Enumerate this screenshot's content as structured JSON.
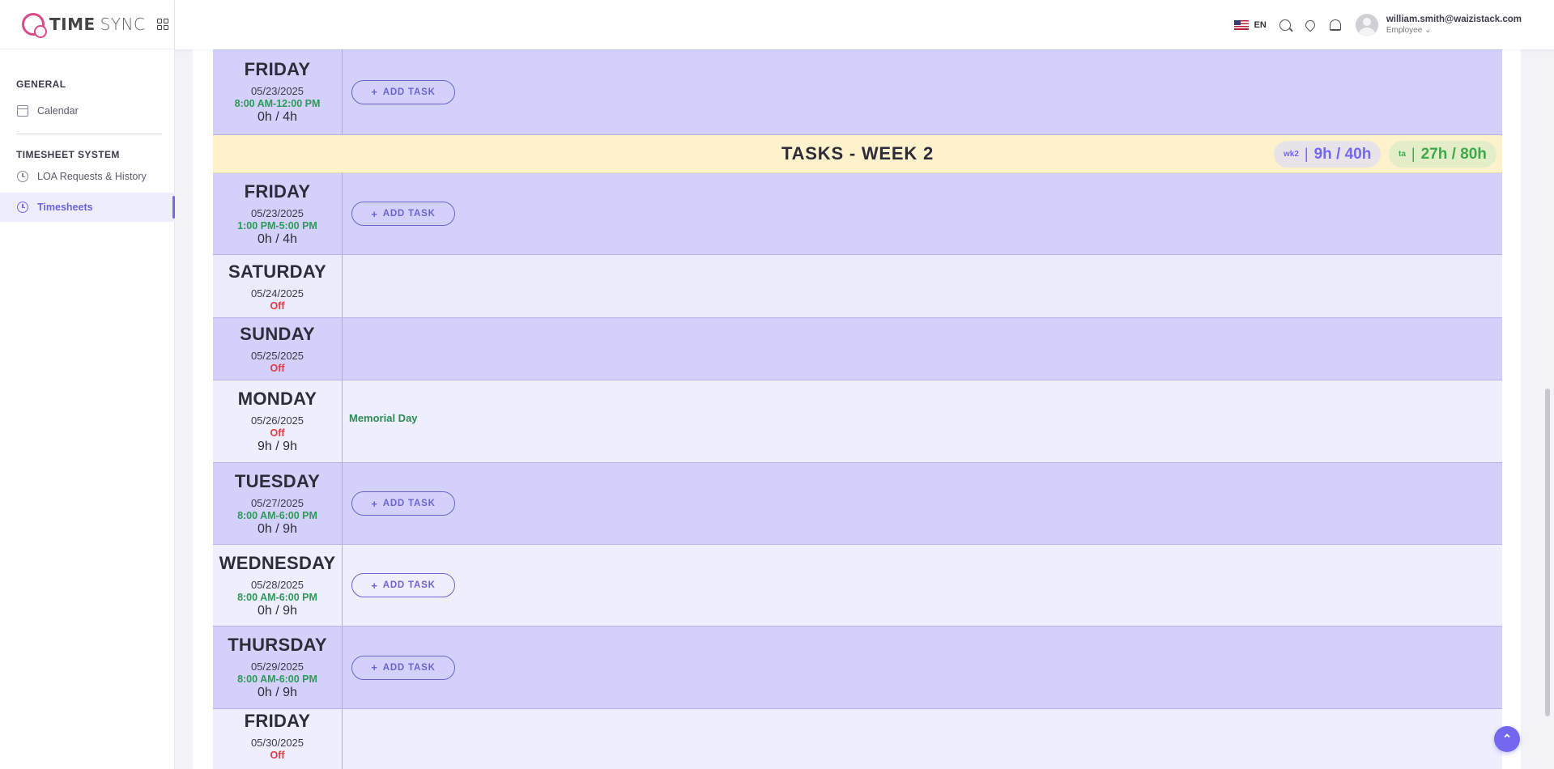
{
  "app": {
    "brand_bold": "TIME",
    "brand_light": "SYNC"
  },
  "sidebar": {
    "sections": [
      {
        "heading": "GENERAL",
        "items": [
          {
            "label": "Calendar",
            "icon": "calendar-icon"
          }
        ]
      },
      {
        "heading": "TIMESHEET SYSTEM",
        "items": [
          {
            "label": "LOA Requests & History",
            "icon": "clock-icon"
          },
          {
            "label": "Timesheets",
            "icon": "clock-icon",
            "active": true
          }
        ]
      }
    ]
  },
  "header": {
    "language": "EN",
    "user_email": "william.smith@waizistack.com",
    "user_role": "Employee"
  },
  "week2": {
    "title": "TASKS - WEEK 2",
    "week_pill_small": "wk2",
    "week_pill_value": "9h / 40h",
    "total_pill_small": "ta",
    "total_pill_value": "27h / 80h"
  },
  "add_task_label": "ADD TASK",
  "days": [
    {
      "name": "FRIDAY",
      "date": "05/23/2025",
      "status": "8:00 AM-12:00 PM",
      "ratio": "0h / 4h"
    },
    {
      "name": "FRIDAY",
      "date": "05/23/2025",
      "status": "1:00 PM-5:00 PM",
      "ratio": "0h / 4h"
    },
    {
      "name": "SATURDAY",
      "date": "05/24/2025",
      "status": "Off"
    },
    {
      "name": "SUNDAY",
      "date": "05/25/2025",
      "status": "Off"
    },
    {
      "name": "MONDAY",
      "date": "05/26/2025",
      "status": "Off",
      "ratio": "9h / 9h",
      "holiday": "Memorial Day"
    },
    {
      "name": "TUESDAY",
      "date": "05/27/2025",
      "status": "8:00 AM-6:00 PM",
      "ratio": "0h / 9h"
    },
    {
      "name": "WEDNESDAY",
      "date": "05/28/2025",
      "status": "8:00 AM-6:00 PM",
      "ratio": "0h / 9h"
    },
    {
      "name": "THURSDAY",
      "date": "05/29/2025",
      "status": "8:00 AM-6:00 PM",
      "ratio": "0h / 9h"
    },
    {
      "name": "FRIDAY",
      "date": "05/30/2025",
      "status": "Off"
    }
  ],
  "colors": {
    "accent": "#7367f0",
    "row_dark": "#d3d1fb",
    "row_light": "#ecebfc",
    "week_band": "#fdf2cc",
    "work_hours": "#2e9a57",
    "off": "#e03a4a"
  }
}
